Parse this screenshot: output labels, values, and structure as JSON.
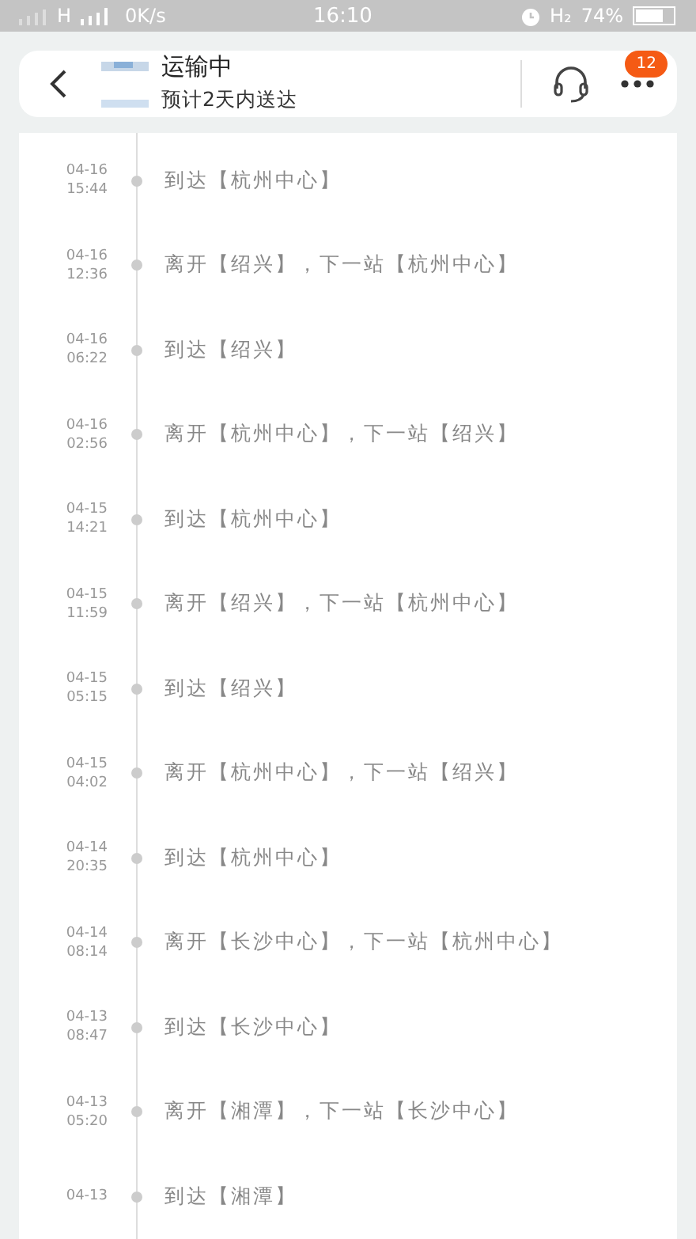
{
  "status_bar": {
    "network": "H",
    "speed": "0K/s",
    "time": "16:10",
    "h2": "H₂",
    "battery": "74%"
  },
  "header": {
    "title": "运输中",
    "subtitle": "预计2天内送达",
    "badge": "12"
  },
  "events": [
    {
      "date": "04-16",
      "time": "15:44",
      "text": "到达【杭州中心】"
    },
    {
      "date": "04-16",
      "time": "12:36",
      "text": "离开【绍兴】，下一站【杭州中心】"
    },
    {
      "date": "04-16",
      "time": "06:22",
      "text": "到达【绍兴】"
    },
    {
      "date": "04-16",
      "time": "02:56",
      "text": "离开【杭州中心】，下一站【绍兴】"
    },
    {
      "date": "04-15",
      "time": "14:21",
      "text": "到达【杭州中心】"
    },
    {
      "date": "04-15",
      "time": "11:59",
      "text": "离开【绍兴】，下一站【杭州中心】"
    },
    {
      "date": "04-15",
      "time": "05:15",
      "text": "到达【绍兴】"
    },
    {
      "date": "04-15",
      "time": "04:02",
      "text": "离开【杭州中心】，下一站【绍兴】"
    },
    {
      "date": "04-14",
      "time": "20:35",
      "text": "到达【杭州中心】"
    },
    {
      "date": "04-14",
      "time": "08:14",
      "text": "离开【长沙中心】，下一站【杭州中心】"
    },
    {
      "date": "04-13",
      "time": "08:47",
      "text": "到达【长沙中心】"
    },
    {
      "date": "04-13",
      "time": "05:20",
      "text": "离开【湘潭】，下一站【长沙中心】"
    },
    {
      "date": "04-13",
      "text": "到达【湘潭】"
    }
  ]
}
